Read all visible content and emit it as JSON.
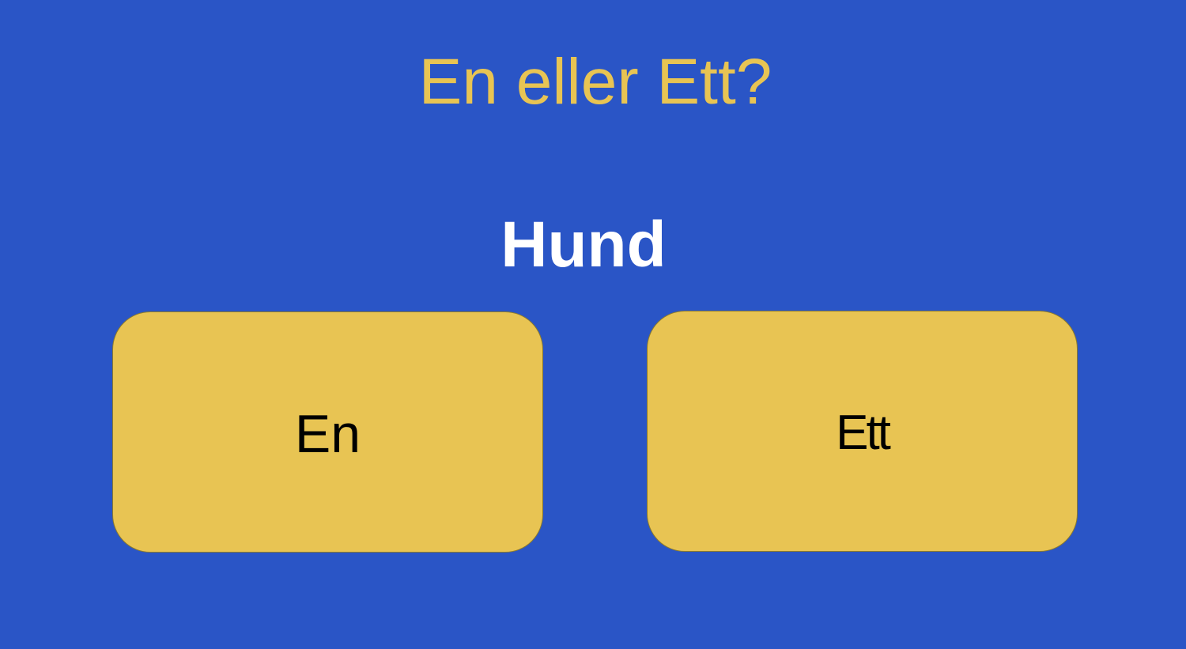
{
  "slide": {
    "title": "En eller Ett?",
    "word": "Hund",
    "choices": [
      {
        "label": "En"
      },
      {
        "label": "Ett"
      }
    ]
  },
  "colors": {
    "background": "#2A55C6",
    "accent": "#E8C453",
    "word": "#FFFFFF",
    "button_text": "#000000"
  }
}
